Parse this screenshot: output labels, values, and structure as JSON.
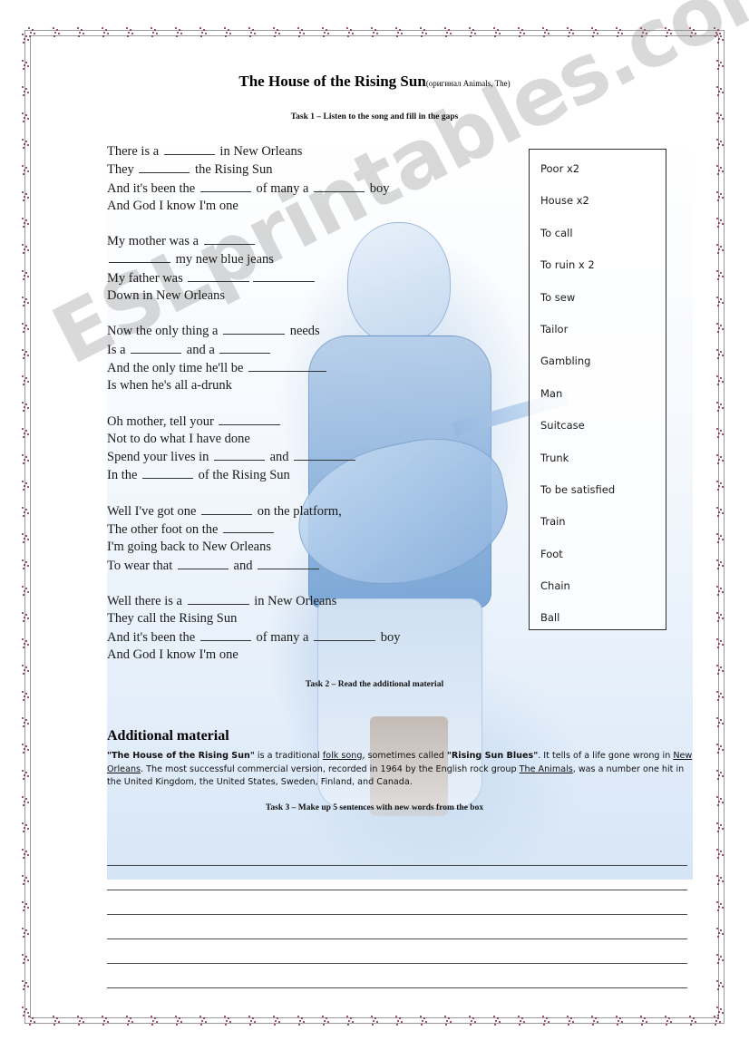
{
  "document": {
    "title": "The House of the Rising Sun",
    "subtitle": "(оригинал Animals, The)",
    "watermark": "ESLprintables.com"
  },
  "tasks": {
    "task1": "Task 1 – Listen to the song and fill in the gaps",
    "task2": "Task 2 – Read the additional material",
    "task3": "Task 3 – Make up 5 sentences with new words from the box"
  },
  "lyrics": {
    "stanzas": [
      {
        "lines": [
          [
            {
              "t": "There is a "
            },
            {
              "gap": "m"
            },
            {
              "t": " in New Orleans"
            }
          ],
          [
            {
              "t": "They "
            },
            {
              "gap": "m"
            },
            {
              "t": " the Rising Sun"
            }
          ],
          [
            {
              "t": "And it's been the "
            },
            {
              "gap": "m"
            },
            {
              "t": " of many a "
            },
            {
              "gap": "m"
            },
            {
              "t": " boy"
            }
          ],
          [
            {
              "t": "And God I know I'm one"
            }
          ]
        ]
      },
      {
        "lines": [
          [
            {
              "t": "My mother was a "
            },
            {
              "gap": "m"
            }
          ],
          [
            {
              "gap": "l"
            },
            {
              "t": " my new blue jeans"
            }
          ],
          [
            {
              "t": "My father was "
            },
            {
              "gap": "l"
            },
            {
              "gap": "l"
            }
          ],
          [
            {
              "t": "Down in New Orleans"
            }
          ]
        ]
      },
      {
        "lines": [
          [
            {
              "t": "Now the only thing a "
            },
            {
              "gap": "l"
            },
            {
              "t": " needs"
            }
          ],
          [
            {
              "t": "Is a "
            },
            {
              "gap": "m"
            },
            {
              "t": " and a "
            },
            {
              "gap": "m"
            }
          ],
          [
            {
              "t": "And the only time he'll be "
            },
            {
              "gap": "xl"
            }
          ],
          [
            {
              "t": "Is when he's all a-drunk"
            }
          ]
        ]
      },
      {
        "lines": [
          [
            {
              "t": "Oh mother, tell your "
            },
            {
              "gap": "l"
            }
          ],
          [
            {
              "t": "Not to do what I have done"
            }
          ],
          [
            {
              "t": "Spend your lives in "
            },
            {
              "gap": "m"
            },
            {
              "t": " and "
            },
            {
              "gap": "l"
            }
          ],
          [
            {
              "t": "In the "
            },
            {
              "gap": "m"
            },
            {
              "t": " of the Rising Sun"
            }
          ]
        ]
      },
      {
        "lines": [
          [
            {
              "t": "Well I've got one "
            },
            {
              "gap": "m"
            },
            {
              "t": " on the platform,"
            }
          ],
          [
            {
              "t": "The other foot on the "
            },
            {
              "gap": "m"
            }
          ],
          [
            {
              "t": "I'm going back to New Orleans"
            }
          ],
          [
            {
              "t": "To wear that "
            },
            {
              "gap": "m"
            },
            {
              "t": " and "
            },
            {
              "gap": "l"
            }
          ]
        ]
      },
      {
        "lines": [
          [
            {
              "t": "Well there is a "
            },
            {
              "gap": "l"
            },
            {
              "t": " in New Orleans"
            }
          ],
          [
            {
              "t": "They call the Rising Sun"
            }
          ],
          [
            {
              "t": "And it's been the "
            },
            {
              "gap": "m"
            },
            {
              "t": " of many a "
            },
            {
              "gap": "l"
            },
            {
              "t": " boy"
            }
          ],
          [
            {
              "t": "And God I know I'm one"
            }
          ]
        ]
      }
    ]
  },
  "wordbox": {
    "words": [
      "Poor x2",
      "House x2",
      "To call",
      "To ruin x 2",
      "To sew",
      "Tailor",
      "Gambling",
      "Man",
      "Suitcase",
      "Trunk",
      "To be satisfied",
      "Train",
      "Foot",
      "Chain",
      "Ball"
    ]
  },
  "additional": {
    "heading": "Additional material",
    "segments": [
      {
        "text": "\"The House of the Rising Sun\"",
        "style": "bold"
      },
      {
        "text": " is a traditional ",
        "style": "plain"
      },
      {
        "text": "folk song",
        "style": "link"
      },
      {
        "text": ", sometimes called ",
        "style": "plain"
      },
      {
        "text": "\"Rising Sun Blues\"",
        "style": "bold"
      },
      {
        "text": ". It tells of a life gone wrong in ",
        "style": "plain"
      },
      {
        "text": "New Orleans",
        "style": "link"
      },
      {
        "text": ". The most successful commercial version, recorded in 1964 by the English rock group ",
        "style": "plain"
      },
      {
        "text": "The Animals",
        "style": "link"
      },
      {
        "text": ", was a number one hit in the United Kingdom, the United States, Sweden, Finland, and Canada.",
        "style": "plain"
      }
    ]
  },
  "answer_lines": {
    "count": 6
  },
  "colors": {
    "border": "#9a9a9a",
    "border_dot": "#7d2233",
    "text": "#1a1a1a",
    "watermark": "rgba(128,128,128,0.30)",
    "artwork_blue": "#8fb4dd"
  }
}
